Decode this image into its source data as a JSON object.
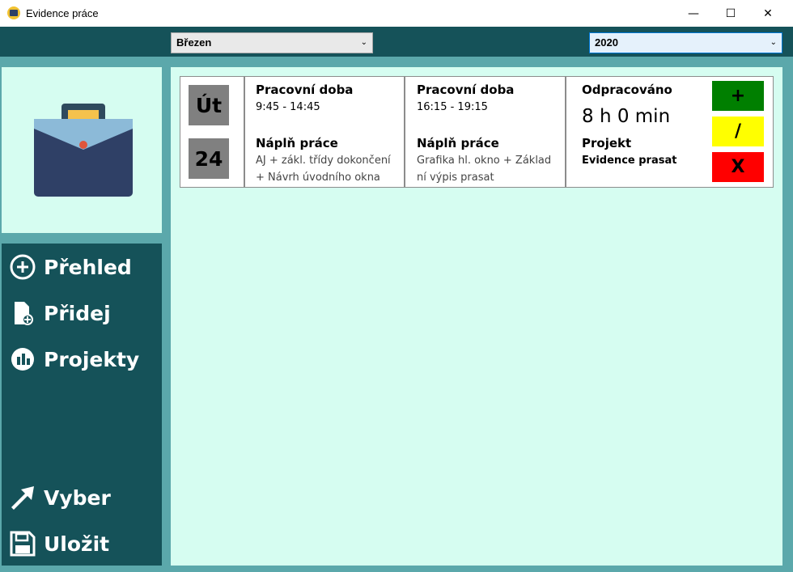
{
  "window": {
    "title": "Evidence práce",
    "minimize": "—",
    "maximize": "☐",
    "close": "✕"
  },
  "filters": {
    "month": "Březen",
    "year": "2020"
  },
  "nav": {
    "overview": "Přehled",
    "add": "Přidej",
    "projects": "Projekty",
    "select": "Vyber",
    "save": "Uložit"
  },
  "records": [
    {
      "day_name": "Út",
      "day_number": "24",
      "shift1": {
        "heading": "Pracovní doba",
        "time": "9:45 - 14:45",
        "content_heading": "Náplň práce",
        "content": "AJ + zákl. třídy dokončení + Návrh úvodního okna"
      },
      "shift2": {
        "heading": "Pracovní doba",
        "time": "16:15 - 19:15",
        "content_heading": "Náplň práce",
        "content": "Grafika hl. okno + Základní výpis prasat"
      },
      "worked_heading": "Odpracováno",
      "worked_value": "8 h 0 min",
      "project_heading": "Projekt",
      "project_name": "Evidence prasat",
      "actions": {
        "add": "+",
        "edit": "/",
        "delete": "X"
      }
    }
  ],
  "colors": {
    "nav_bg": "#155259",
    "frame_bg": "#5ba8ab",
    "content_bg": "#d6fdf1",
    "add_button": "#007f00",
    "edit_button": "#ffff00",
    "delete_button": "#ff0000",
    "day_box": "#808080"
  }
}
